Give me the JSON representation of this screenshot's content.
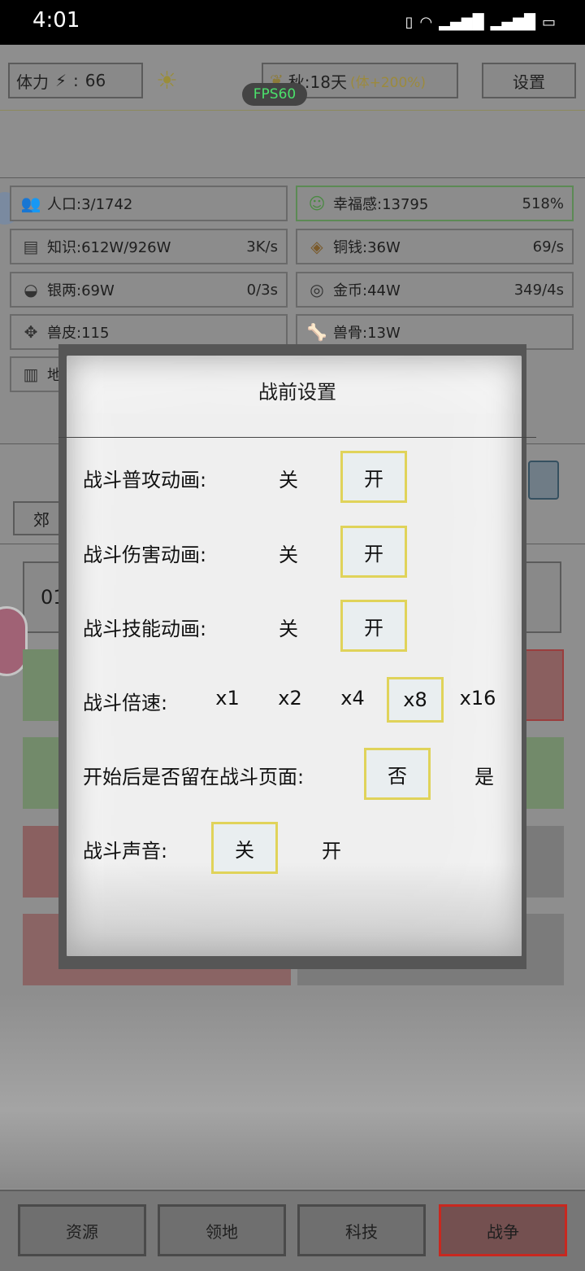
{
  "status_bar": {
    "time": "4:01",
    "icons": [
      "vibrate-icon",
      "wifi-icon",
      "signal-4g-icon",
      "signal-4g-icon",
      "battery-charging-icon"
    ]
  },
  "hud": {
    "stamina_label": "体力",
    "stamina_value": "66",
    "season": "秋:18天",
    "season_bonus": "(体+200%)",
    "settings_label": "设置",
    "fps": "FPS60"
  },
  "resources": [
    {
      "icon": "people-icon",
      "label": "人口:3/1742",
      "value": ""
    },
    {
      "icon": "smile-icon",
      "label": "幸福感:13795",
      "value": "518%"
    },
    {
      "icon": "book-icon",
      "label": "知识:612W/926W",
      "value": "3K/s"
    },
    {
      "icon": "copper-coin-icon",
      "label": "铜钱:36W",
      "value": "69/s"
    },
    {
      "icon": "silver-ingot-icon",
      "label": "银两:69W",
      "value": "0/3s"
    },
    {
      "icon": "gold-coin-icon",
      "label": "金币:44W",
      "value": "349/4s"
    },
    {
      "icon": "hide-icon",
      "label": "兽皮:115",
      "value": ""
    },
    {
      "icon": "bone-icon",
      "label": "兽骨:13W",
      "value": ""
    },
    {
      "icon": "map-scroll-icon",
      "label": "地",
      "value": ""
    }
  ],
  "partial": {
    "tab_left": "郊",
    "row_text": "01"
  },
  "modal": {
    "title": "战前设置",
    "rows": [
      {
        "label": "战斗普攻动画:",
        "options": [
          "关",
          "开"
        ],
        "selected": "开"
      },
      {
        "label": "战斗伤害动画:",
        "options": [
          "关",
          "开"
        ],
        "selected": "开"
      },
      {
        "label": "战斗技能动画:",
        "options": [
          "关",
          "开"
        ],
        "selected": "开"
      },
      {
        "label": "战斗倍速:",
        "options": [
          "x1",
          "x2",
          "x4",
          "x8",
          "x16"
        ],
        "selected": "x8"
      },
      {
        "label": "开始后是否留在战斗页面:",
        "options": [
          "否",
          "是"
        ],
        "selected": "否"
      },
      {
        "label": "战斗声音:",
        "options": [
          "关",
          "开"
        ],
        "selected": "关"
      }
    ]
  },
  "bottom_nav": [
    {
      "label": "资源"
    },
    {
      "label": "领地"
    },
    {
      "label": "科技"
    },
    {
      "label": "战争",
      "active": true
    }
  ],
  "colors": {
    "selected_border": "#e0d35a",
    "active_tab_border": "#c8281f",
    "fps_text": "#4be16b"
  }
}
